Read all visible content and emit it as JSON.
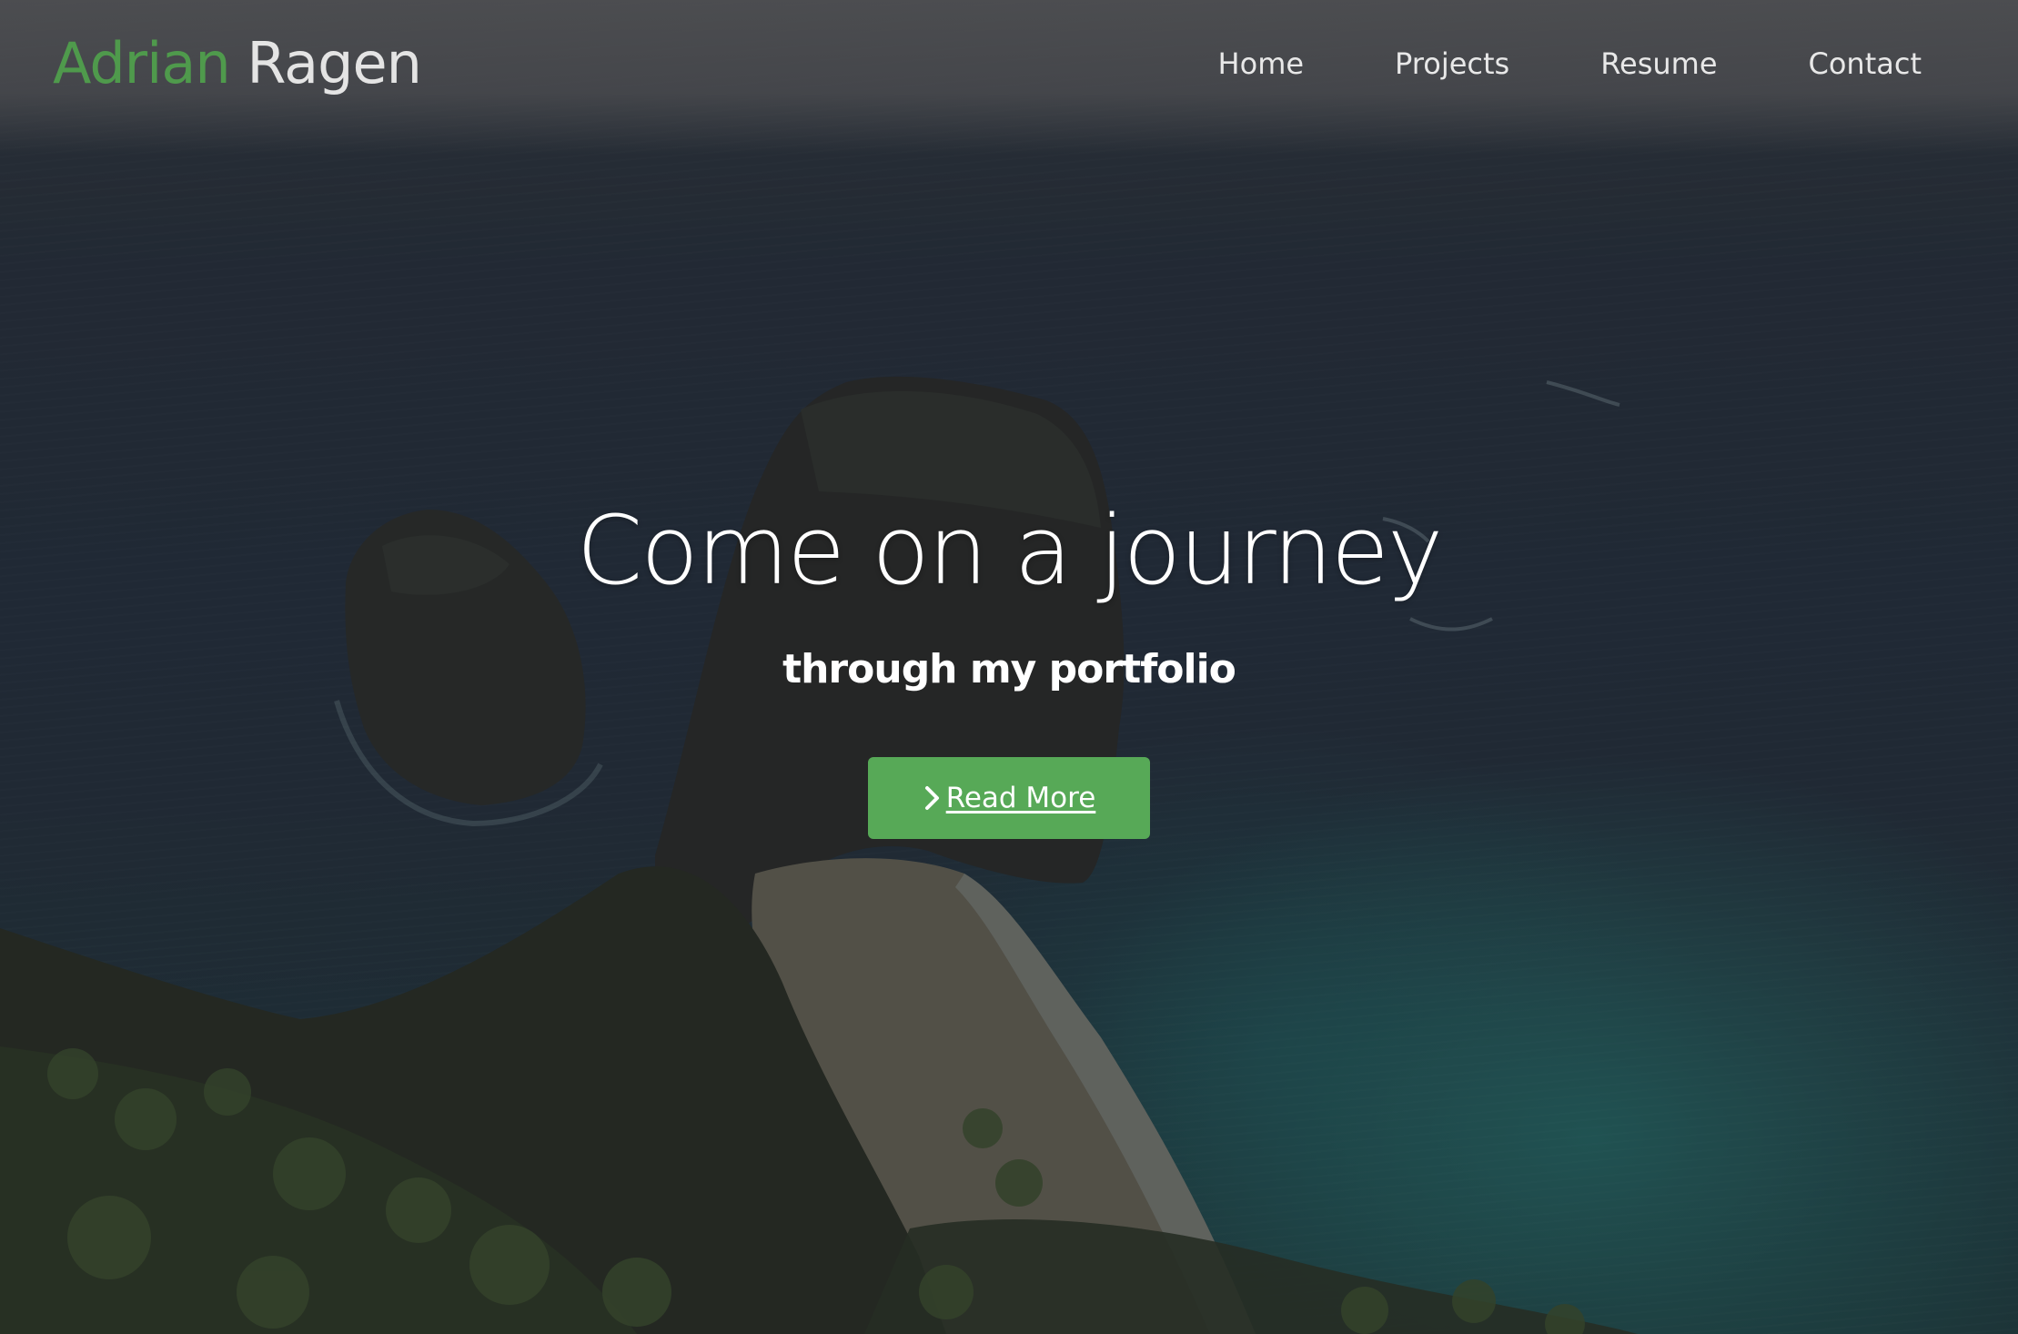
{
  "header": {
    "brand_first": "Adrian",
    "brand_last": "Ragen",
    "nav": [
      {
        "label": "Home"
      },
      {
        "label": "Projects"
      },
      {
        "label": "Resume"
      },
      {
        "label": "Contact"
      }
    ]
  },
  "hero": {
    "title": "Come on a journey",
    "subtitle": "through my portfolio",
    "cta": {
      "icon": "chevron-right-icon",
      "label": "Read More"
    }
  },
  "colors": {
    "brand_accent": "#4f9a4c",
    "button_bg": "#57a957",
    "text_light": "#ffffff"
  }
}
